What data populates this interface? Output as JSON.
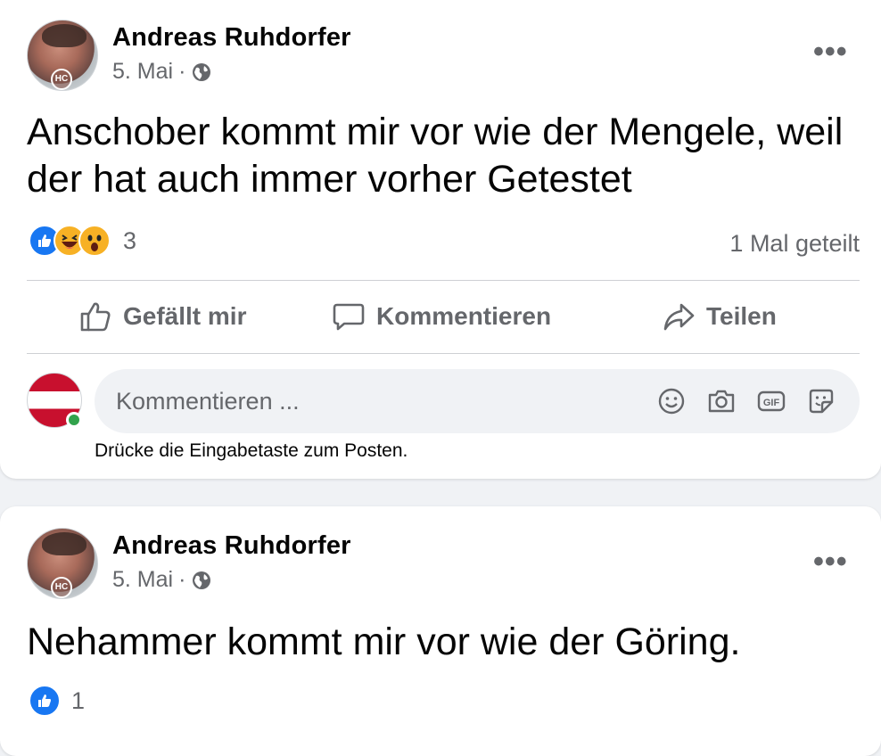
{
  "posts": [
    {
      "author": "Andreas Ruhdorfer",
      "date": "5. Mai",
      "separator": "·",
      "avatar_badge": "HC",
      "more_label": "•••",
      "text": "Anschober kommt mir vor wie der Mengele, weil der hat auch immer vorher Getestet",
      "reactions": [
        "like",
        "haha",
        "wow"
      ],
      "reaction_count": "3",
      "shares": "1 Mal geteilt",
      "actions": {
        "like": "Gefällt mir",
        "comment": "Kommentieren",
        "share": "Teilen"
      },
      "comment_placeholder": "Kommentieren ...",
      "comment_hint": "Drücke die Eingabetaste zum Posten."
    },
    {
      "author": "Andreas Ruhdorfer",
      "date": "5. Mai",
      "separator": "·",
      "avatar_badge": "HC",
      "more_label": "•••",
      "text": "Nehammer kommt mir vor wie der Göring.",
      "reactions": [
        "like"
      ],
      "reaction_count": "1"
    }
  ],
  "colors": {
    "like_blue": "#1877f2",
    "secondary_text": "#65676b",
    "online_green": "#31a24c"
  }
}
